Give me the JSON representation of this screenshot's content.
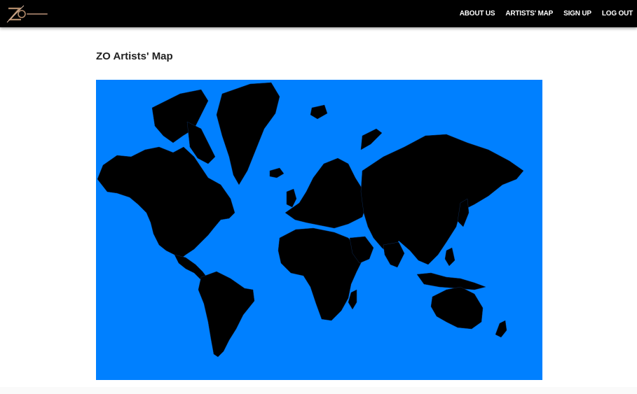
{
  "header": {
    "logo_brand": "ZO magazine",
    "nav": [
      {
        "label": "ABOUT US"
      },
      {
        "label": "ARTISTS' MAP"
      },
      {
        "label": "SIGN UP"
      },
      {
        "label": "LOG OUT"
      }
    ]
  },
  "main": {
    "title": "ZO Artists' Map"
  },
  "colors": {
    "navbar": "#000000",
    "ocean": "#0080ff",
    "land": "#000000",
    "title": "#222222"
  }
}
